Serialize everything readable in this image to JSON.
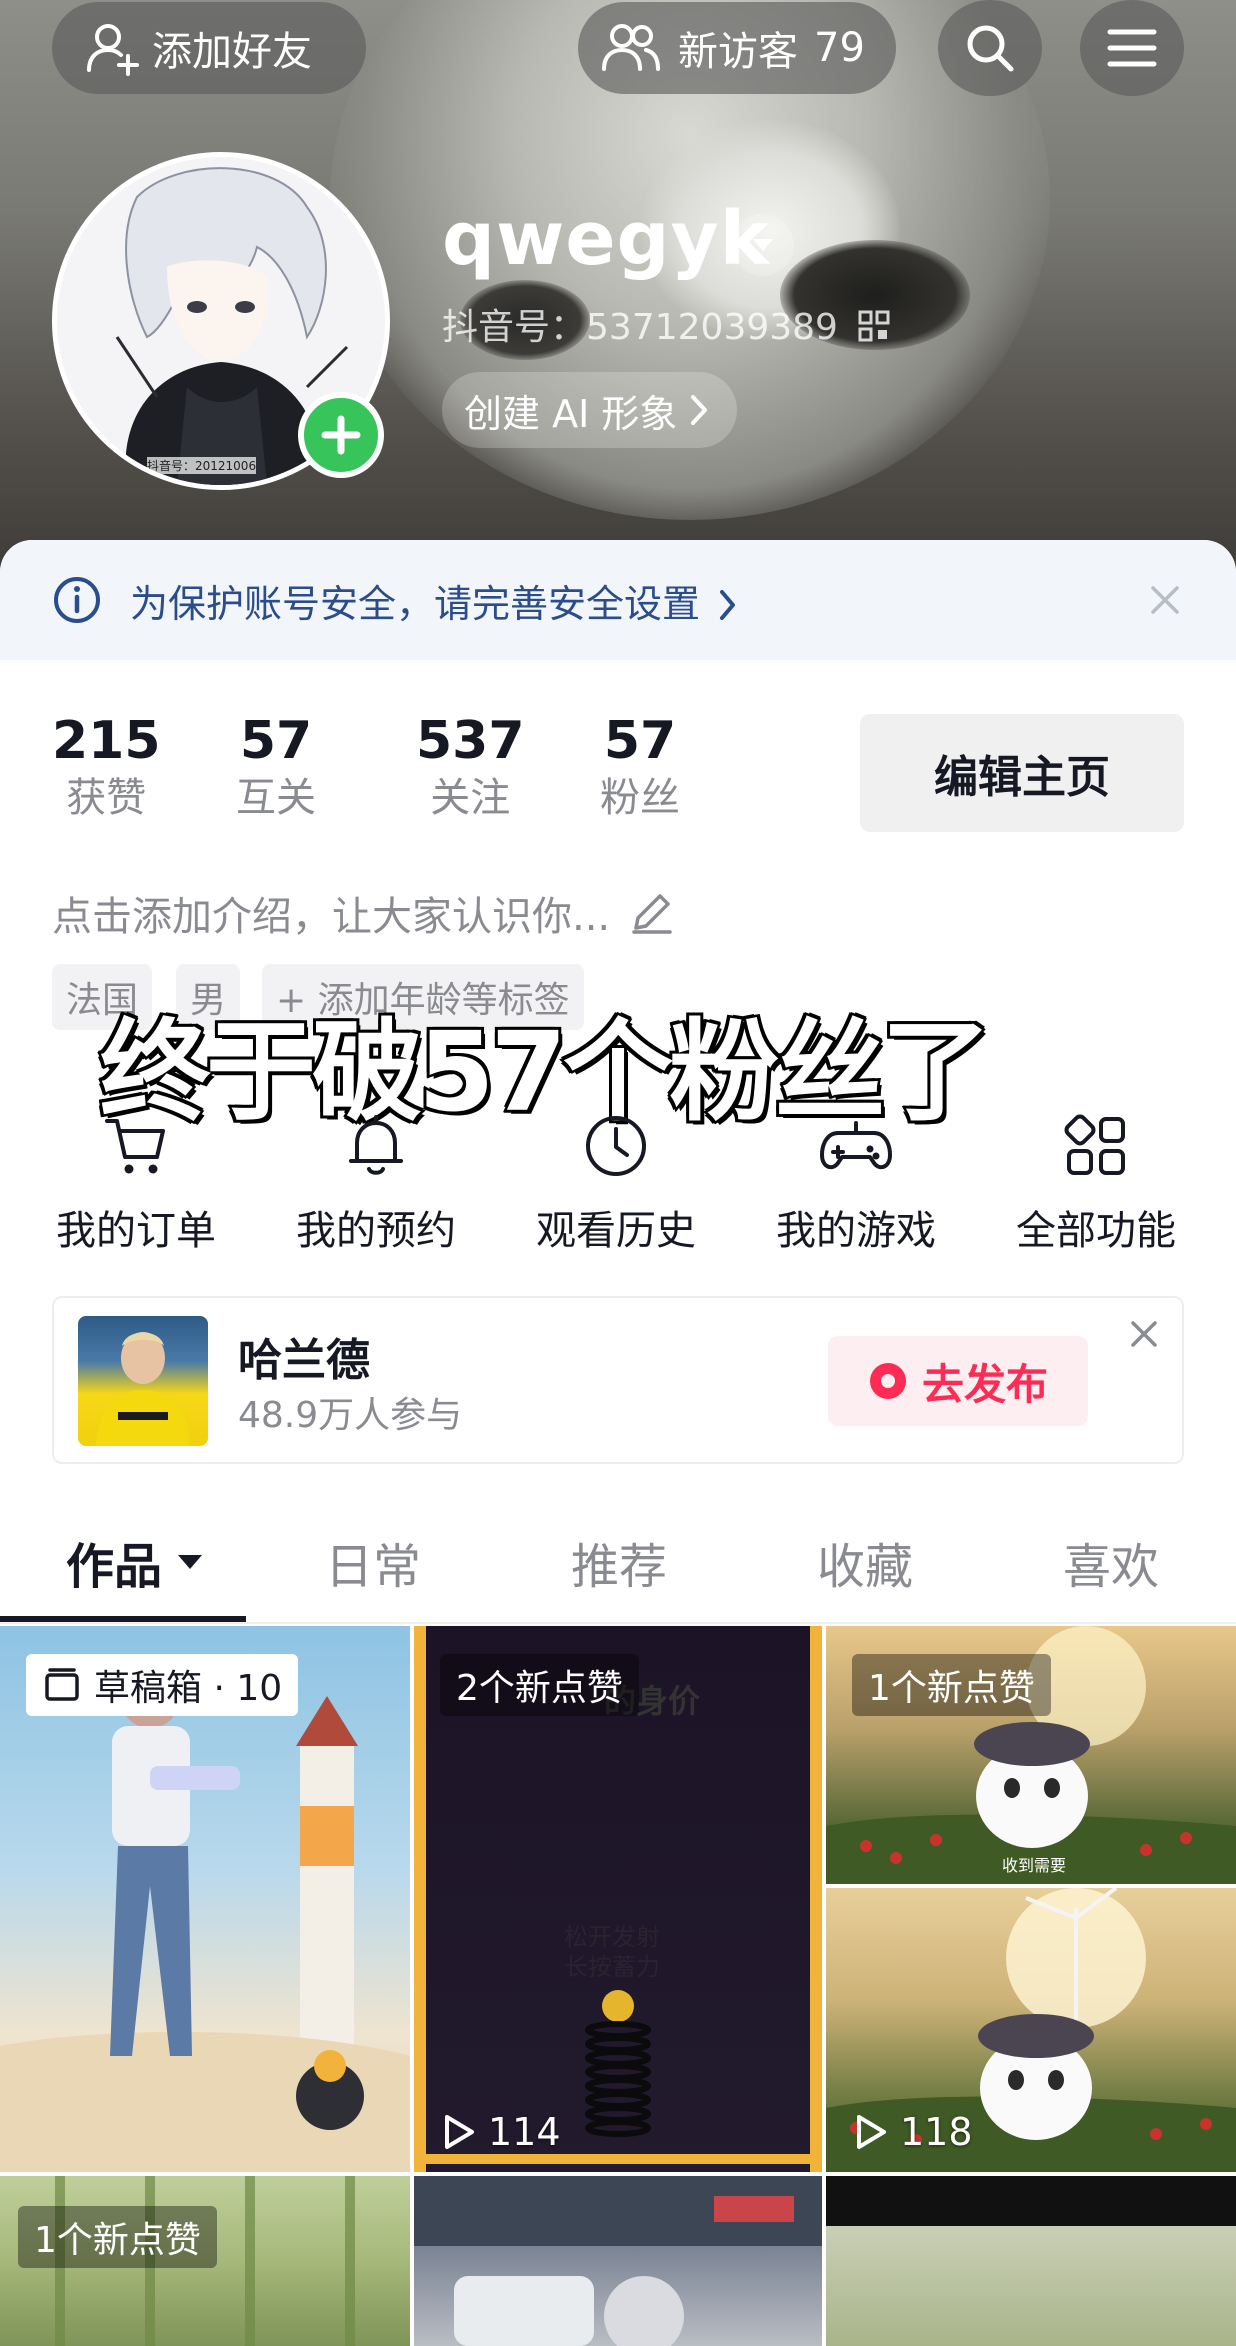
{
  "header": {
    "add_friend_label": "添加好友",
    "visitors_label": "新访客",
    "visitors_count": "79",
    "username": "qwegyk",
    "uid_label": "抖音号：",
    "uid_value": "53712039389",
    "ai_avatar_label": "创建 AI 形象",
    "avatar_watermark": "抖音号：20121006"
  },
  "security": {
    "text": "为保护账号安全，请完善安全设置"
  },
  "stats": [
    {
      "value": "215",
      "label": "获赞"
    },
    {
      "value": "57",
      "label": "互关"
    },
    {
      "value": "537",
      "label": "关注"
    },
    {
      "value": "57",
      "label": "粉丝"
    }
  ],
  "edit_profile_label": "编辑主页",
  "bio_placeholder": "点击添加介绍，让大家认识你...",
  "tags": [
    "法国",
    "男",
    "+ 添加年龄等标签"
  ],
  "overlay_caption": "终于破57个粉丝了",
  "functions": [
    {
      "label": "我的订单",
      "icon": "cart-icon"
    },
    {
      "label": "我的预约",
      "icon": "bell-icon"
    },
    {
      "label": "观看历史",
      "icon": "clock-icon"
    },
    {
      "label": "我的游戏",
      "icon": "gamepad-icon"
    },
    {
      "label": "全部功能",
      "icon": "grid-icon"
    }
  ],
  "banner": {
    "title": "哈兰德",
    "subtitle": "48.9万人参与",
    "button_label": "去发布"
  },
  "tabs": [
    {
      "label": "作品",
      "active": true
    },
    {
      "label": "日常",
      "active": false
    },
    {
      "label": "推荐",
      "active": false
    },
    {
      "label": "收藏",
      "active": false
    },
    {
      "label": "喜欢",
      "active": false
    }
  ],
  "videos": [
    {
      "badge": "草稿箱 · 10",
      "plays": ""
    },
    {
      "badge": "2个新点赞",
      "plays": "114",
      "inner_text_1": "的身价",
      "inner_text_2": "松开发射",
      "inner_text_3": "长按蓄力"
    },
    {
      "badge": "1个新点赞",
      "plays": "",
      "inner_text": "收到需要"
    },
    {
      "badge": "",
      "plays": "118"
    },
    {
      "badge": "1个新点赞",
      "plays": ""
    },
    {
      "badge": "",
      "plays": ""
    },
    {
      "badge": "",
      "plays": ""
    }
  ],
  "colors": {
    "accent": "#fe2c55",
    "green": "#37c45b",
    "security_text": "#2c4d8c"
  }
}
